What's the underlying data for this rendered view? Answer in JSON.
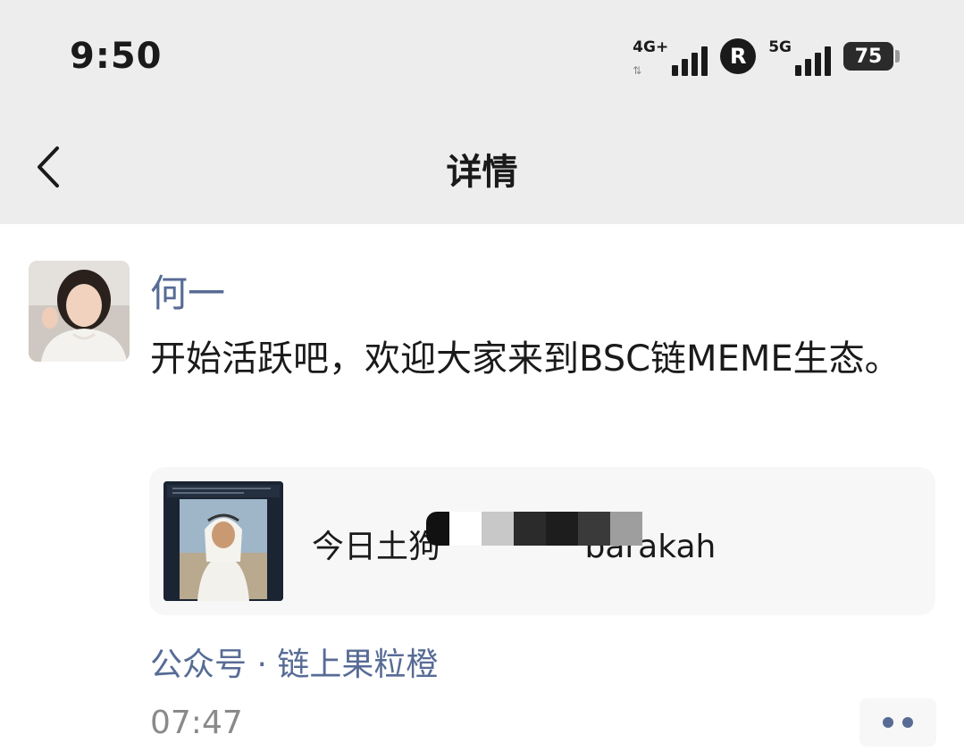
{
  "status_bar": {
    "time": "9:50",
    "network_1": "4G+",
    "network_1_arrows": "⇅",
    "roaming": "R",
    "network_2": "5G",
    "battery": "75"
  },
  "nav": {
    "back_icon": "chevron-left-icon",
    "title": "详情"
  },
  "post": {
    "author": "何一",
    "text": "开始活跃吧，欢迎大家来到BSC链MEME生态。",
    "link_card": {
      "title": "今日土狗",
      "title_tail": "barakah"
    },
    "source": "公众号 · 链上果粒橙",
    "time": "07:47",
    "more_icon": "more-dots-icon"
  },
  "colors": {
    "header_bg": "#ededed",
    "link_blue": "#576b95",
    "card_bg": "#f7f7f7"
  }
}
